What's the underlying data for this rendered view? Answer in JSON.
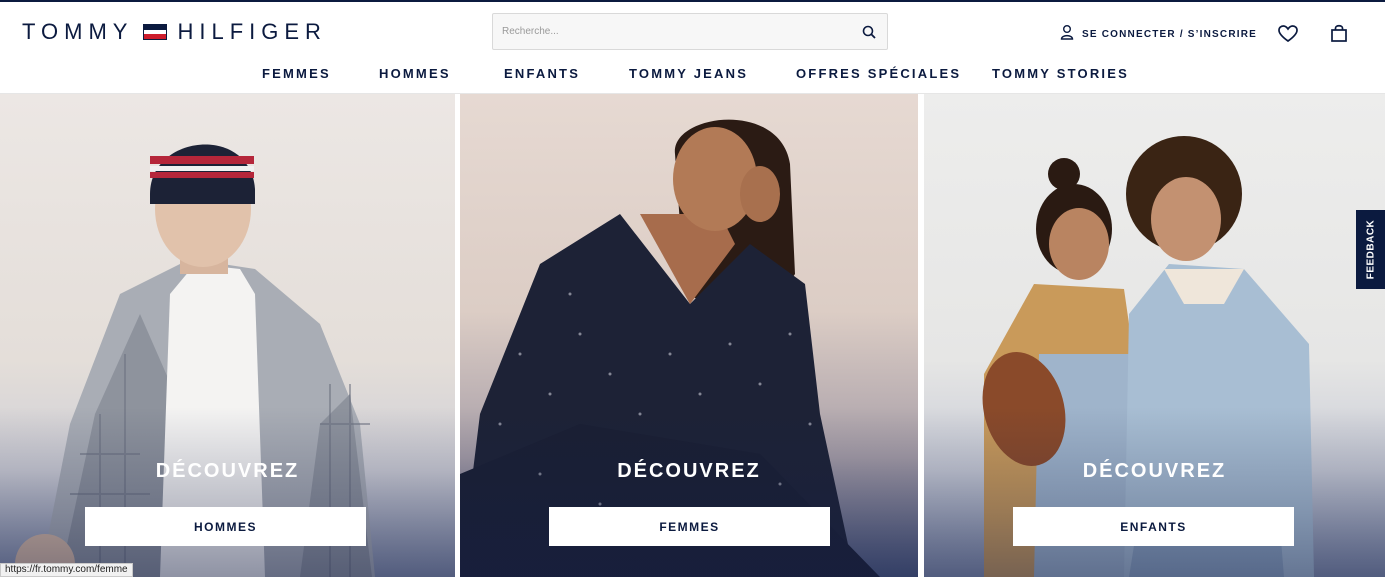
{
  "brand": {
    "left": "TOMMY",
    "right": "HILFIGER"
  },
  "search": {
    "placeholder": "Recherche...",
    "value": ""
  },
  "account": {
    "label": "SE CONNECTER / S’INSCRIRE"
  },
  "nav": [
    {
      "label": "FEMMES"
    },
    {
      "label": "HOMMES"
    },
    {
      "label": "ENFANTS"
    },
    {
      "label": "TOMMY JEANS"
    },
    {
      "label": "OFFRES SPÉCIALES"
    },
    {
      "label": "TOMMY STORIES"
    }
  ],
  "panels": [
    {
      "heading": "DÉCOUVREZ",
      "button": "HOMMES"
    },
    {
      "heading": "DÉCOUVREZ",
      "button": "FEMMES"
    },
    {
      "heading": "DÉCOUVREZ",
      "button": "ENFANTS"
    }
  ],
  "feedback": "FEEDBACK",
  "status_url": "https://fr.tommy.com/femme",
  "colors": {
    "navy": "#0b1a3f",
    "red": "#cd1c2c",
    "white": "#ffffff"
  },
  "icons": [
    "search-icon",
    "user-icon",
    "heart-icon",
    "shopping-bag-icon",
    "flag-logo-icon"
  ]
}
